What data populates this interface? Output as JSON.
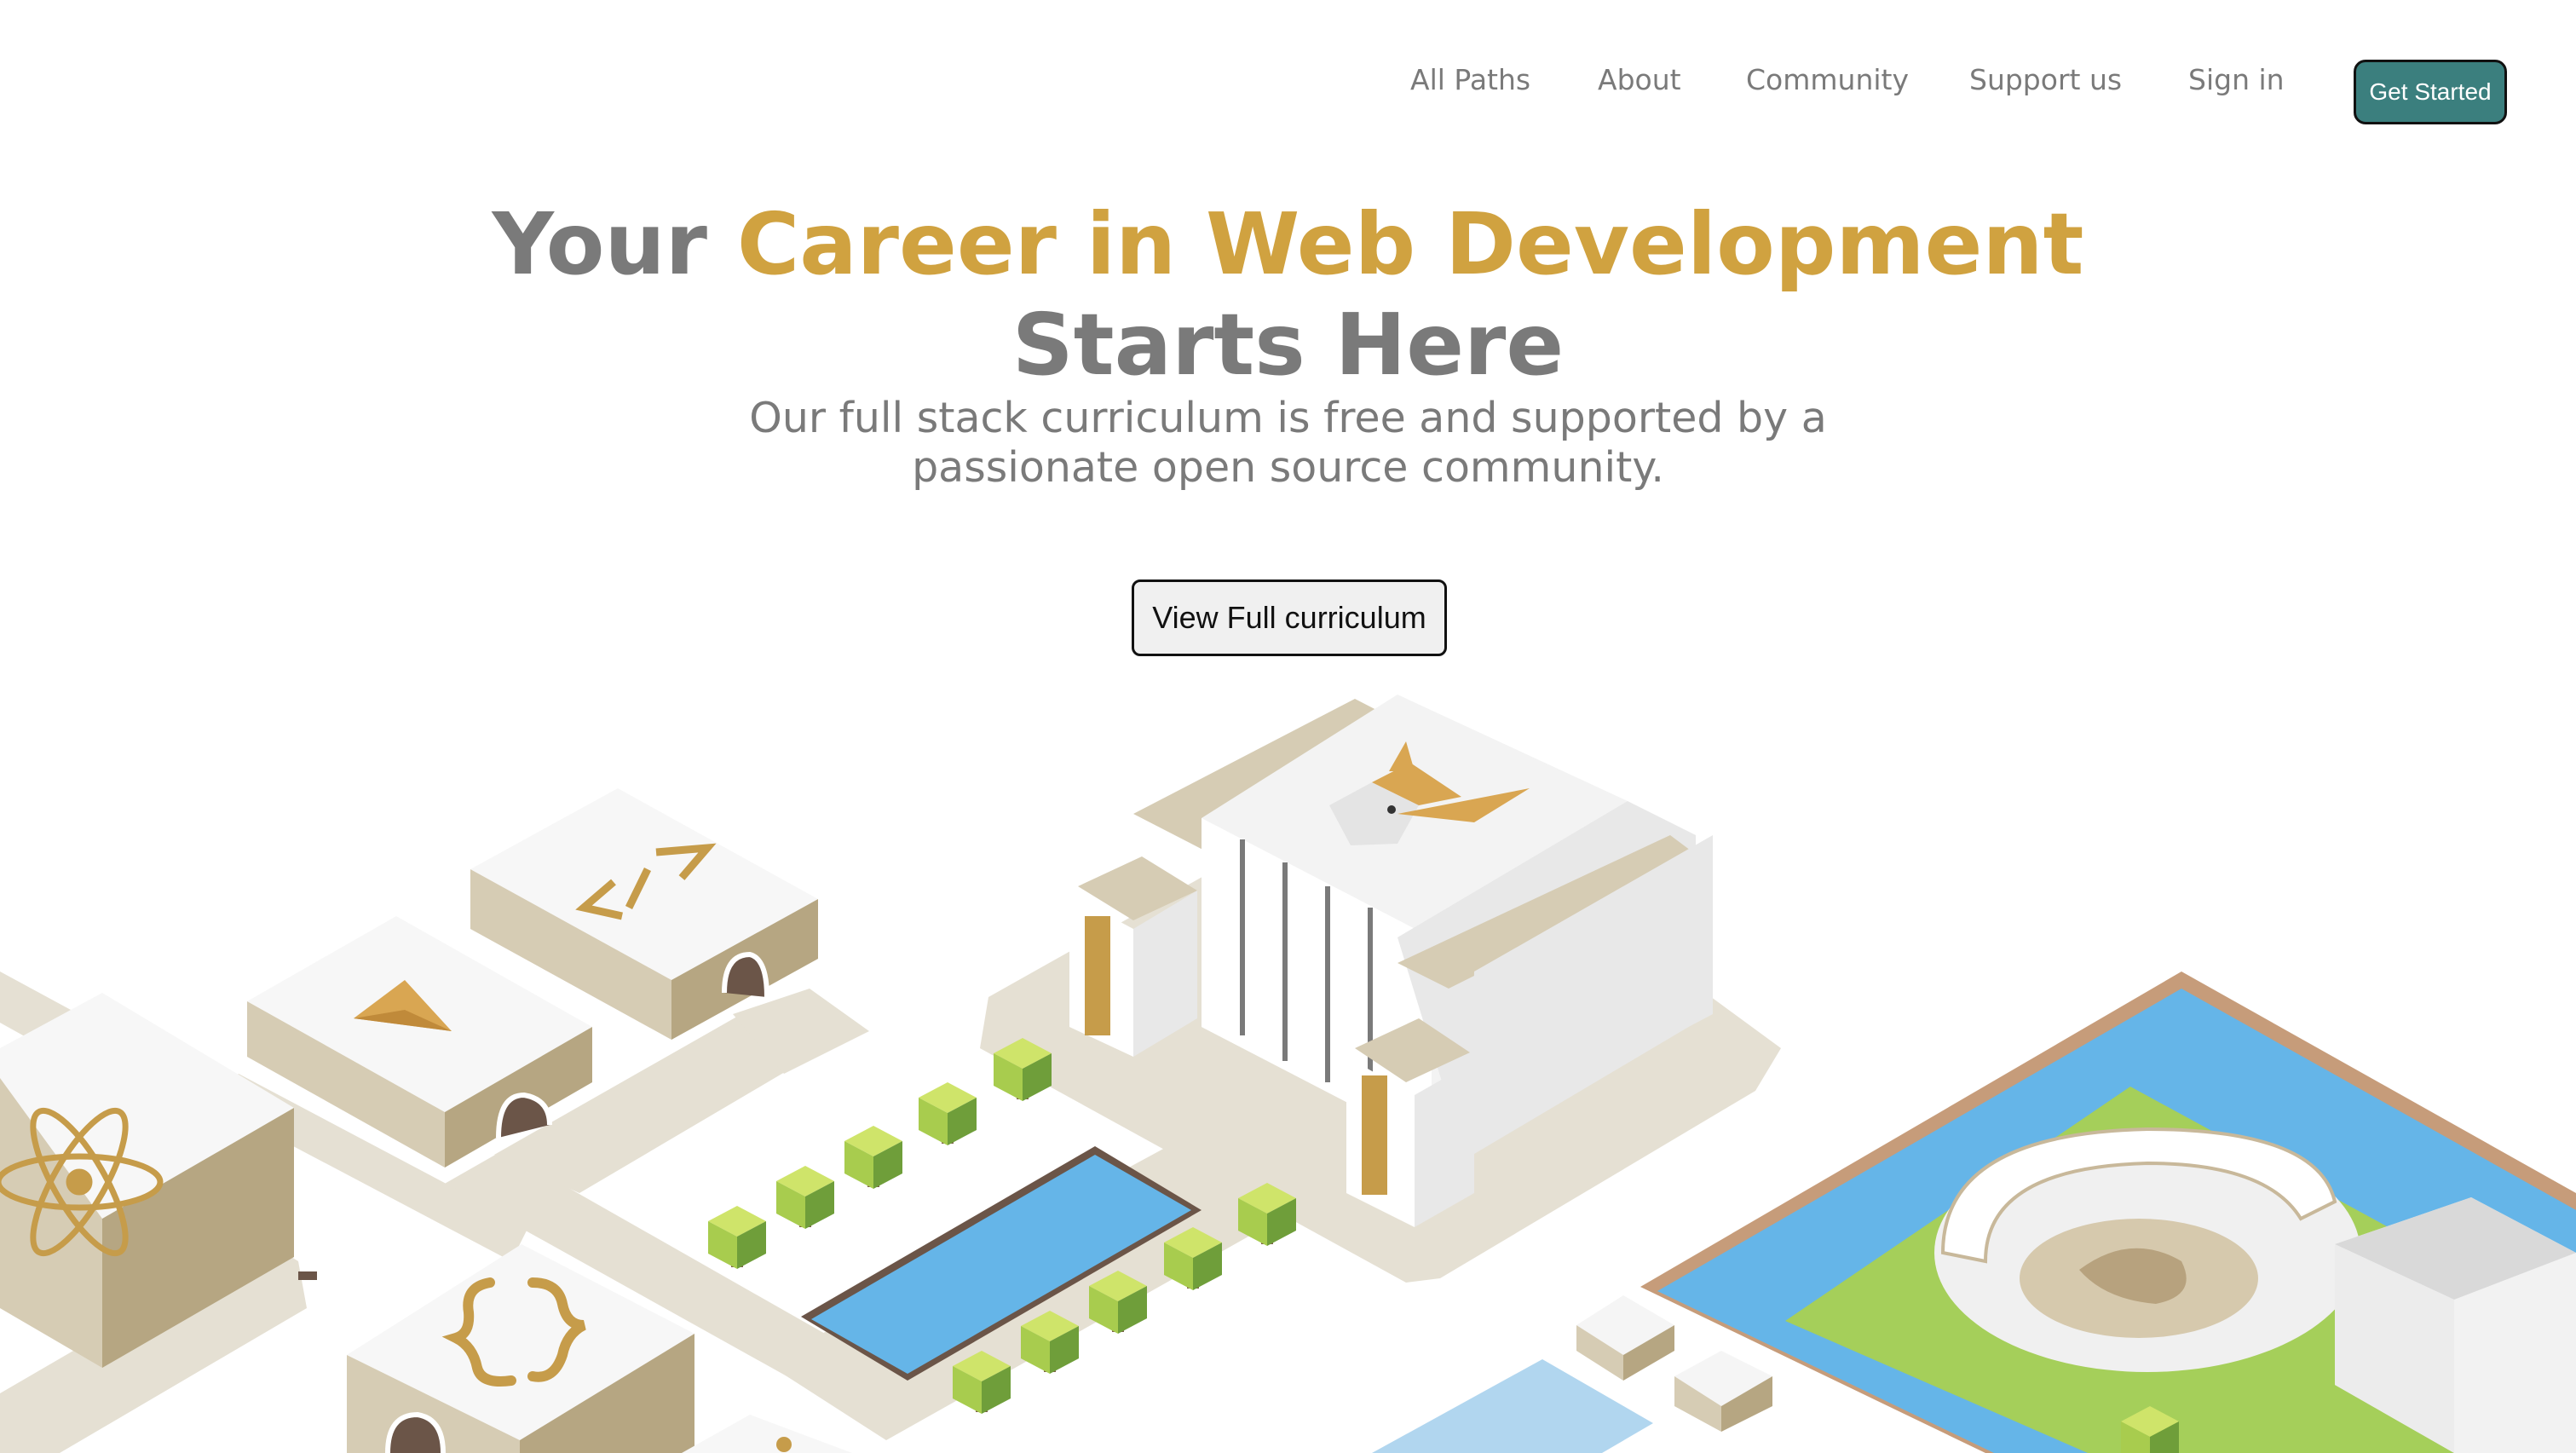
{
  "nav": {
    "links": [
      "All Paths",
      "About",
      "Community",
      "Support us",
      "Sign in"
    ],
    "cta_label": "Get Started"
  },
  "hero": {
    "title_lead": "Your ",
    "title_accent": "Career in Web Development",
    "title_tail": "Starts Here",
    "subtitle_line1": "Our full stack curriculum is free and supported by a",
    "subtitle_line2": "passionate open source community.",
    "button_label": "View Full curriculum"
  },
  "colors": {
    "accent_gold": "#d0a240",
    "button_teal": "#3b7f7e",
    "text_gray": "#7a7a7a",
    "water_blue": "#65b5e8",
    "grass_green": "#a5cf5a"
  },
  "illustration": {
    "icons": [
      "react-atom-icon",
      "gem-icon",
      "code-tag-icon",
      "curly-braces-icon",
      "viking-helmet-icon",
      "fox-mascot-icon"
    ]
  }
}
